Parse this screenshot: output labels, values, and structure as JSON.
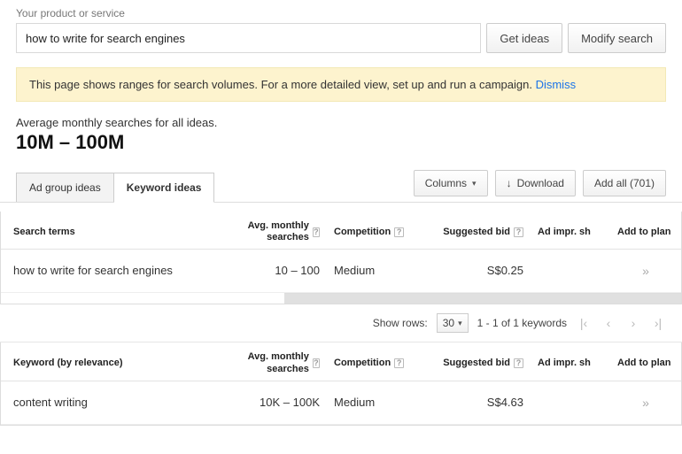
{
  "search": {
    "label": "Your product or service",
    "value": "how to write for search engines",
    "get_ideas": "Get ideas",
    "modify_search": "Modify search"
  },
  "banner": {
    "text": "This page shows ranges for search volumes. For a more detailed view, set up and run a campaign. ",
    "dismiss": "Dismiss"
  },
  "average": {
    "label": "Average monthly searches for all ideas.",
    "range": "10M – 100M"
  },
  "tabs": {
    "group": "Ad group ideas",
    "keyword": "Keyword ideas"
  },
  "toolbar": {
    "columns": "Columns",
    "download": "Download",
    "add_all": "Add all (701)"
  },
  "headers": {
    "search_terms": "Search terms",
    "avg_monthly": "Avg. monthly searches",
    "competition": "Competition",
    "suggested_bid": "Suggested bid",
    "ad_impr": "Ad impr. sh",
    "add_to_plan": "Add to plan",
    "keyword_by_relevance": "Keyword (by relevance)"
  },
  "rows1": [
    {
      "term": "how to write for search engines",
      "avg": "10 – 100",
      "competition": "Medium",
      "bid": "S$0.25",
      "impr": ""
    }
  ],
  "pager": {
    "show_rows_label": "Show rows:",
    "show_rows_value": "30",
    "status": "1 - 1 of 1 keywords"
  },
  "rows2": [
    {
      "term": "content writing",
      "avg": "10K – 100K",
      "competition": "Medium",
      "bid": "S$4.63",
      "impr": ""
    }
  ],
  "glyphs": {
    "chevron_right_double": "»",
    "caret_down": "▾",
    "first": "|‹",
    "prev": "‹",
    "next": "›",
    "last": "›|",
    "download_arrow": "↓"
  }
}
